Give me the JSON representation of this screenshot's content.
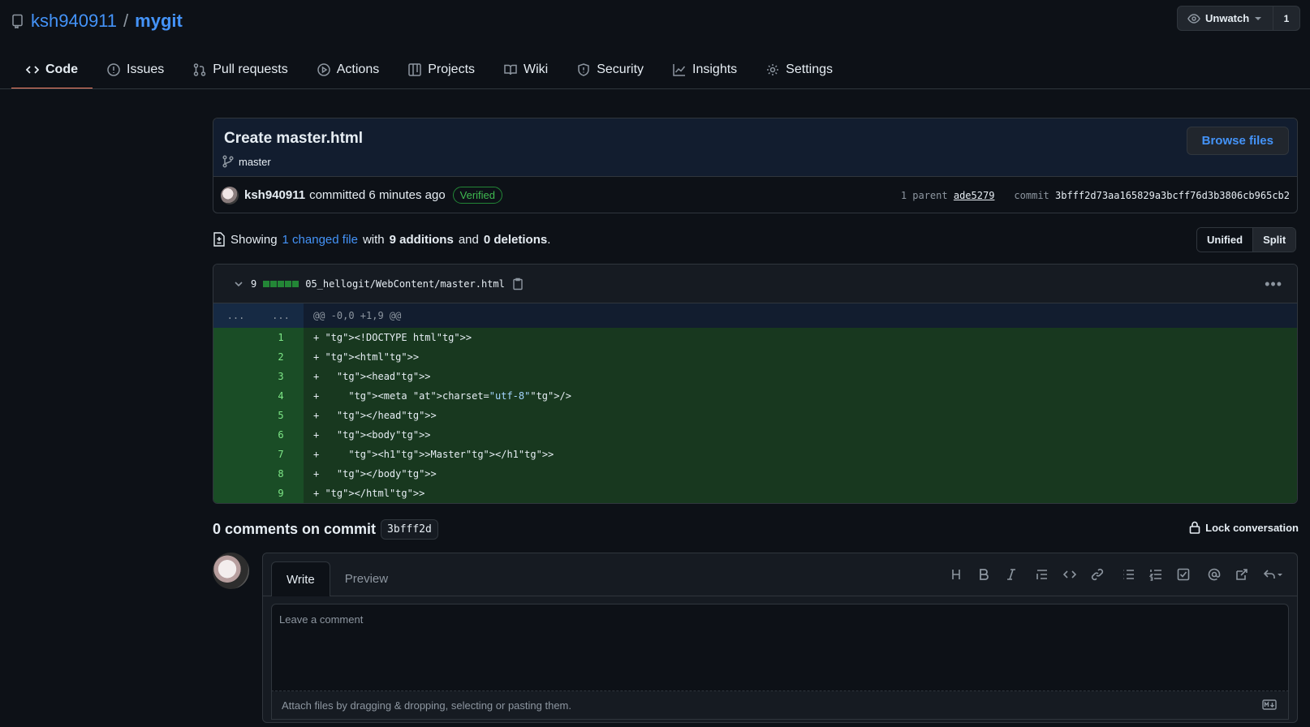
{
  "repo": {
    "owner": "ksh940911",
    "separator": "/",
    "name": "mygit"
  },
  "watch": {
    "label": "Unwatch",
    "count": "1"
  },
  "tabs": [
    {
      "label": "Code",
      "icon": "code-icon",
      "active": true
    },
    {
      "label": "Issues",
      "icon": "issue-icon"
    },
    {
      "label": "Pull requests",
      "icon": "pull-request-icon"
    },
    {
      "label": "Actions",
      "icon": "play-icon"
    },
    {
      "label": "Projects",
      "icon": "table-icon"
    },
    {
      "label": "Wiki",
      "icon": "book-icon"
    },
    {
      "label": "Security",
      "icon": "shield-icon"
    },
    {
      "label": "Insights",
      "icon": "graph-icon"
    },
    {
      "label": "Settings",
      "icon": "gear-icon"
    }
  ],
  "commit": {
    "title": "Create master.html",
    "branch": "master",
    "browse_label": "Browse files",
    "author": "ksh940911",
    "action": "committed 6 minutes ago",
    "verified": "Verified",
    "parent_label": "1 parent",
    "parent_sha": "ade5279",
    "commit_label": "commit",
    "sha": "3bfff2d73aa165829a3bcff76d3b3806cb965cb2"
  },
  "summary": {
    "prefix": "Showing",
    "changed": "1 changed file",
    "with": "with",
    "additions": "9 additions",
    "and": "and",
    "deletions": "0 deletions",
    "suffix": "."
  },
  "view_toggle": {
    "unified": "Unified",
    "split": "Split"
  },
  "file": {
    "count": "9",
    "path": "05_hellogit/WebContent/master.html",
    "hunk_left": "...",
    "hunk_right": "...",
    "hunk_header": "@@ -0,0 +1,9 @@",
    "lines": [
      {
        "n": "1",
        "text": "+ <!DOCTYPE html>"
      },
      {
        "n": "2",
        "text": "+ <html>"
      },
      {
        "n": "3",
        "text": "+   <head>"
      },
      {
        "n": "4",
        "text": "+     <meta charset=\"utf-8\"/>"
      },
      {
        "n": "5",
        "text": "+   </head>"
      },
      {
        "n": "6",
        "text": "+   <body>"
      },
      {
        "n": "7",
        "text": "+     <h1>Master</h1>"
      },
      {
        "n": "8",
        "text": "+   </body>"
      },
      {
        "n": "9",
        "text": "+ </html>"
      }
    ]
  },
  "comments": {
    "title": "0 comments on commit",
    "sha_short": "3bfff2d",
    "lock_label": "Lock conversation"
  },
  "editor": {
    "tab_write": "Write",
    "tab_preview": "Preview",
    "placeholder": "Leave a comment",
    "footer": "Attach files by dragging & dropping, selecting or pasting them."
  }
}
